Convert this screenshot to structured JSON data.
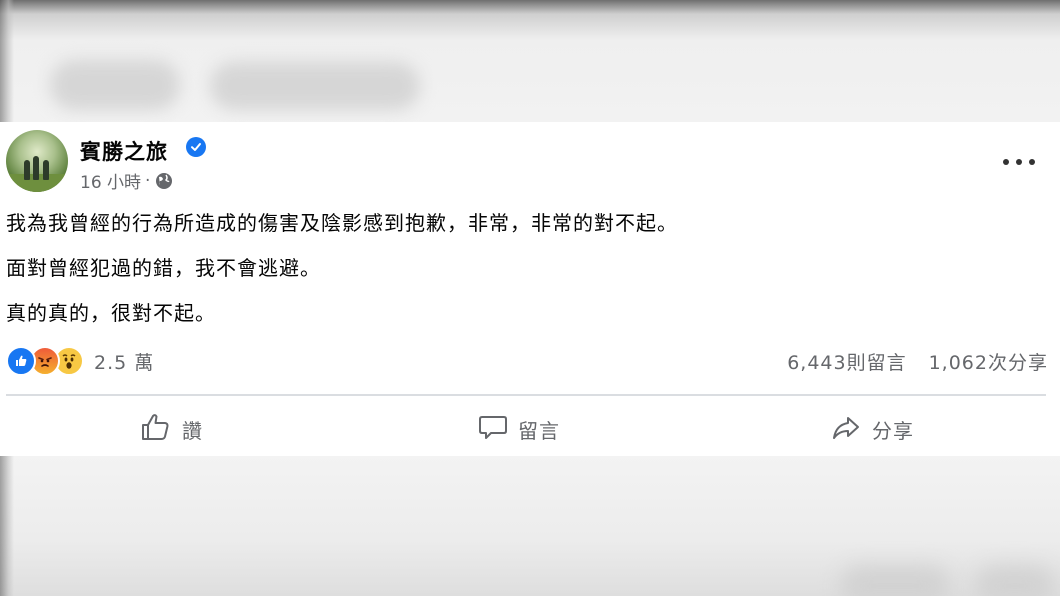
{
  "post": {
    "author": "賓勝之旅",
    "time": "16 小時",
    "time_separator": "·",
    "lines": [
      "我為我曾經的行為所造成的傷害及陰影感到抱歉，非常，非常的對不起。",
      "面對曾經犯過的錯，我不會逃避。",
      "真的真的，很對不起。"
    ],
    "reactions": {
      "icons": [
        "like-reaction",
        "angry-reaction",
        "wow-reaction"
      ],
      "count": "2.5 萬"
    },
    "comments_count": "6,443則留言",
    "shares_count": "1,062次分享"
  },
  "actions": {
    "like_label": "讚",
    "comment_label": "留言",
    "share_label": "分享"
  },
  "colors": {
    "brand_blue": "#1877f2",
    "secondary_text": "#65676b",
    "primary_text": "#050505"
  }
}
